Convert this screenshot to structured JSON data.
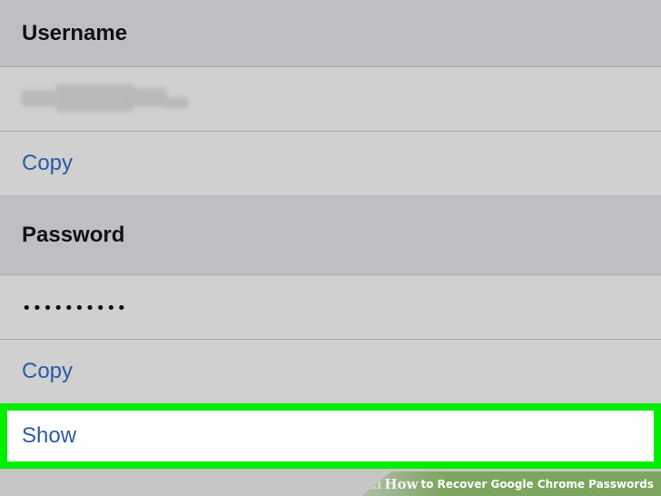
{
  "sections": {
    "username": {
      "header": "Username",
      "copy_label": "Copy"
    },
    "password": {
      "header": "Password",
      "masked_value": "••••••••••",
      "copy_label": "Copy",
      "show_label": "Show"
    }
  },
  "watermark": {
    "wiki": "wiki",
    "how": "How",
    "title": "to Recover Google Chrome Passwords"
  },
  "colors": {
    "link": "#2d5aa8",
    "highlight": "#00ee00",
    "background": "#c8c8c8",
    "watermark": "#7ca55f"
  }
}
